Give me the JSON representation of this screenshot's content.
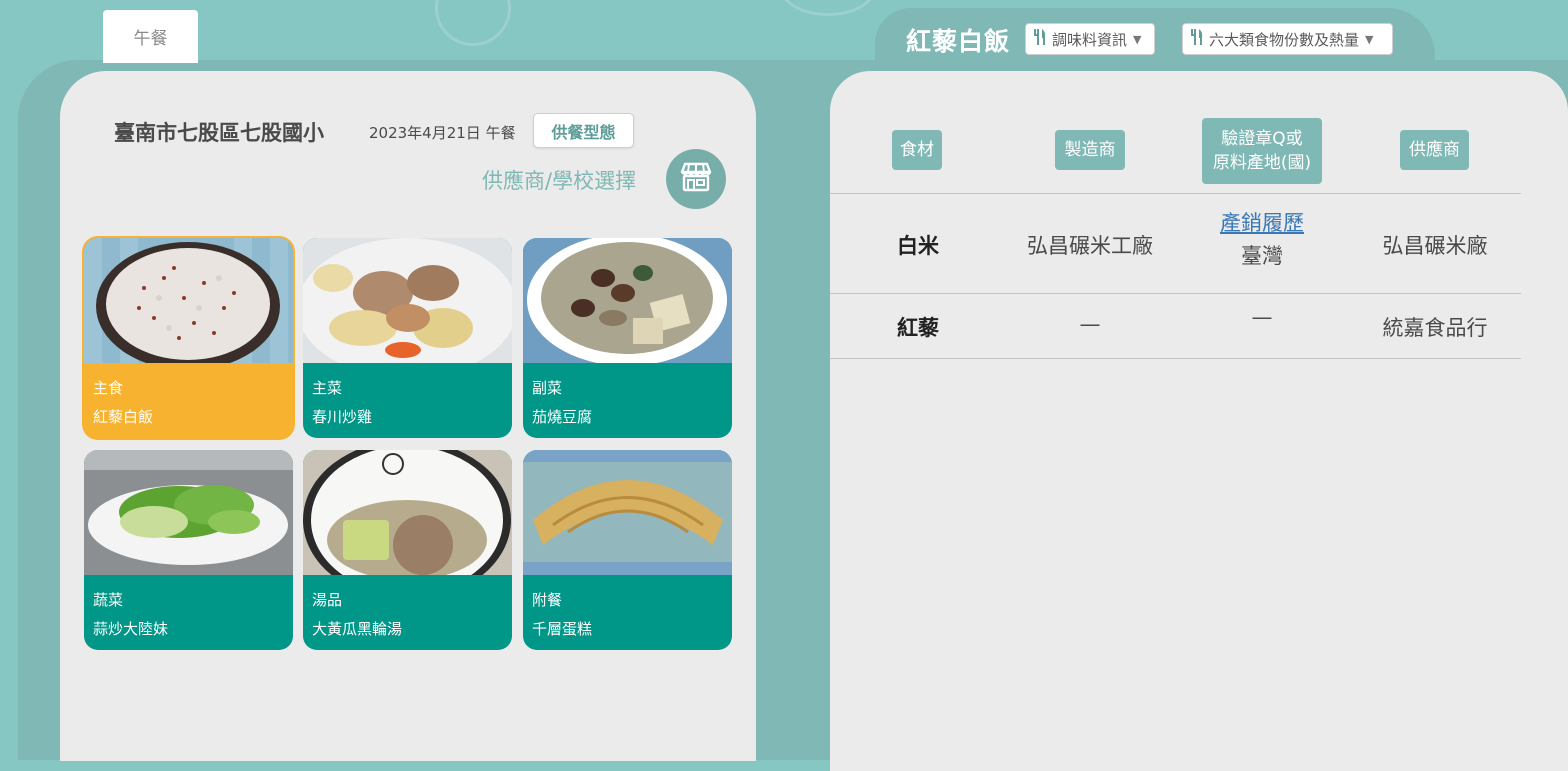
{
  "tabs": {
    "lunch": "午餐"
  },
  "school": {
    "name": "臺南市七股區七股國小",
    "date_meal": "2023年4月21日 午餐",
    "supply_type_label": "供餐型態",
    "supplier_select_label": "供應商/學校選擇"
  },
  "dishes": [
    {
      "category": "主食",
      "name": "紅藜白飯",
      "active": true
    },
    {
      "category": "主菜",
      "name": "春川炒雞"
    },
    {
      "category": "副菜",
      "name": "茄燒豆腐"
    },
    {
      "category": "蔬菜",
      "name": "蒜炒大陸妹"
    },
    {
      "category": "湯品",
      "name": "大黃瓜黑輪湯"
    },
    {
      "category": "附餐",
      "name": "千層蛋糕"
    }
  ],
  "detail": {
    "title": "紅藜白飯",
    "dropdown_seasoning": "調味料資訊",
    "dropdown_food_groups": "六大類食物份數及熱量"
  },
  "table": {
    "headers": {
      "ingredient": "食材",
      "manufacturer": "製造商",
      "cert_line1": "驗證章Q或",
      "cert_line2": "原料產地(國)",
      "supplier": "供應商"
    },
    "rows": [
      {
        "ingredient": "白米",
        "manufacturer": "弘昌碾米工廠",
        "trace_link": "產銷履歷",
        "origin": "臺灣",
        "supplier": "弘昌碾米廠"
      },
      {
        "ingredient": "紅藜",
        "manufacturer": "—",
        "origin": "—",
        "supplier": "統嘉食品行"
      }
    ]
  },
  "colors": {
    "teal_bg": "#86c6c3",
    "teal_panel": "#7fb8b4",
    "dish_teal": "#009688",
    "dish_active": "#f7b32f",
    "link": "#3a78b5"
  }
}
